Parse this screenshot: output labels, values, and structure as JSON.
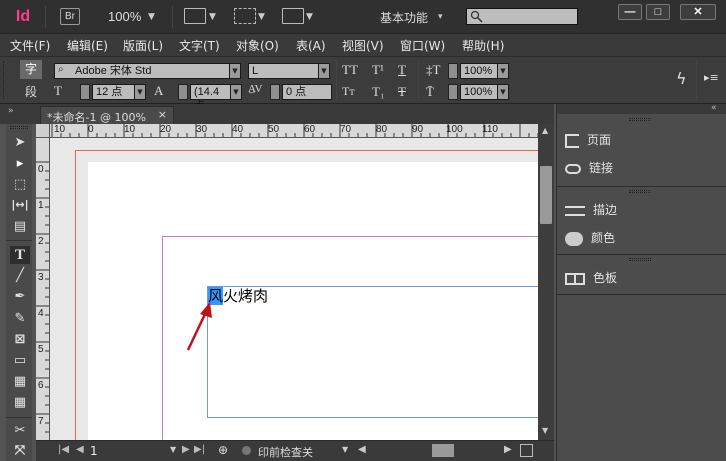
{
  "app": {
    "logo": "Id",
    "bridge": "Br",
    "zoom": "100%",
    "workspace": "基本功能",
    "search_placeholder": ""
  },
  "window_buttons": [
    "—",
    "□",
    "✕"
  ],
  "menu": [
    "文件(F)",
    "编辑(E)",
    "版面(L)",
    "文字(T)",
    "对象(O)",
    "表(A)",
    "视图(V)",
    "窗口(W)",
    "帮助(H)"
  ],
  "control": {
    "char_label": "字",
    "para_label": "段",
    "font_family": "Adobe 宋体 Std",
    "font_style": "L",
    "font_size": "12 点",
    "leading": "(14.4 点",
    "tracking": "0 点",
    "h_scale": "100%",
    "v_scale": "100%"
  },
  "document_tab": {
    "title": "*未命名-1 @ 100%",
    "close": "×"
  },
  "ruler_h_labels": [
    "10",
    "0",
    "10",
    "20",
    "30",
    "40",
    "50",
    "60",
    "70",
    "80",
    "90",
    "100",
    "110"
  ],
  "ruler_v_labels": [
    "0",
    "1",
    "2",
    "3",
    "4",
    "5",
    "6",
    "7"
  ],
  "canvas": {
    "frame_text_selected": "风",
    "frame_text_rest": "火烤肉"
  },
  "status": {
    "page": "1",
    "preflight": "印前检查关"
  },
  "panels": [
    {
      "label": "页面",
      "icon": "pages-icon"
    },
    {
      "label": "链接",
      "icon": "links-icon"
    },
    {
      "label": "描边",
      "icon": "stroke-icon"
    },
    {
      "label": "颜色",
      "icon": "color-icon"
    },
    {
      "label": "色板",
      "icon": "swatches-icon"
    }
  ],
  "colors": {
    "accent_pink": "#ff3d8a",
    "arrow": "#c0121a",
    "selection": "#3399ff",
    "frame": "#6b9fd6"
  }
}
